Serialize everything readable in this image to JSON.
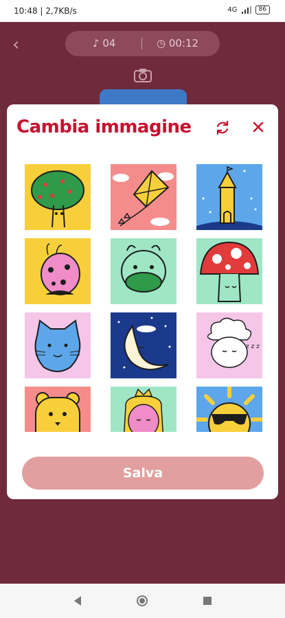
{
  "status": {
    "time": "10:48 | 2,7KB/s",
    "signal_label": "4G",
    "battery": "86"
  },
  "header": {
    "notes_count": "04",
    "timer": "00:12"
  },
  "modal": {
    "title": "Cambia immagine",
    "save_label": "Salva",
    "images": [
      {
        "name": "tree",
        "bg": "#f7cf3a"
      },
      {
        "name": "kite",
        "bg": "#f58c8c"
      },
      {
        "name": "castle",
        "bg": "#5da6ea"
      },
      {
        "name": "ladybug",
        "bg": "#f7cf3a"
      },
      {
        "name": "dragon",
        "bg": "#9fe6c5"
      },
      {
        "name": "mushroom",
        "bg": "#9fe6c5"
      },
      {
        "name": "cat",
        "bg": "#f5c6e8"
      },
      {
        "name": "moon",
        "bg": "#1b3a8c"
      },
      {
        "name": "sheep",
        "bg": "#f5c6e8"
      },
      {
        "name": "bear",
        "bg": "#f58c8c"
      },
      {
        "name": "princess",
        "bg": "#9fe6c5"
      },
      {
        "name": "sun",
        "bg": "#5da6ea"
      }
    ]
  },
  "colors": {
    "accent": "#c8102e",
    "backdrop": "#6f2a3b",
    "save_button": "#e09a9a"
  }
}
